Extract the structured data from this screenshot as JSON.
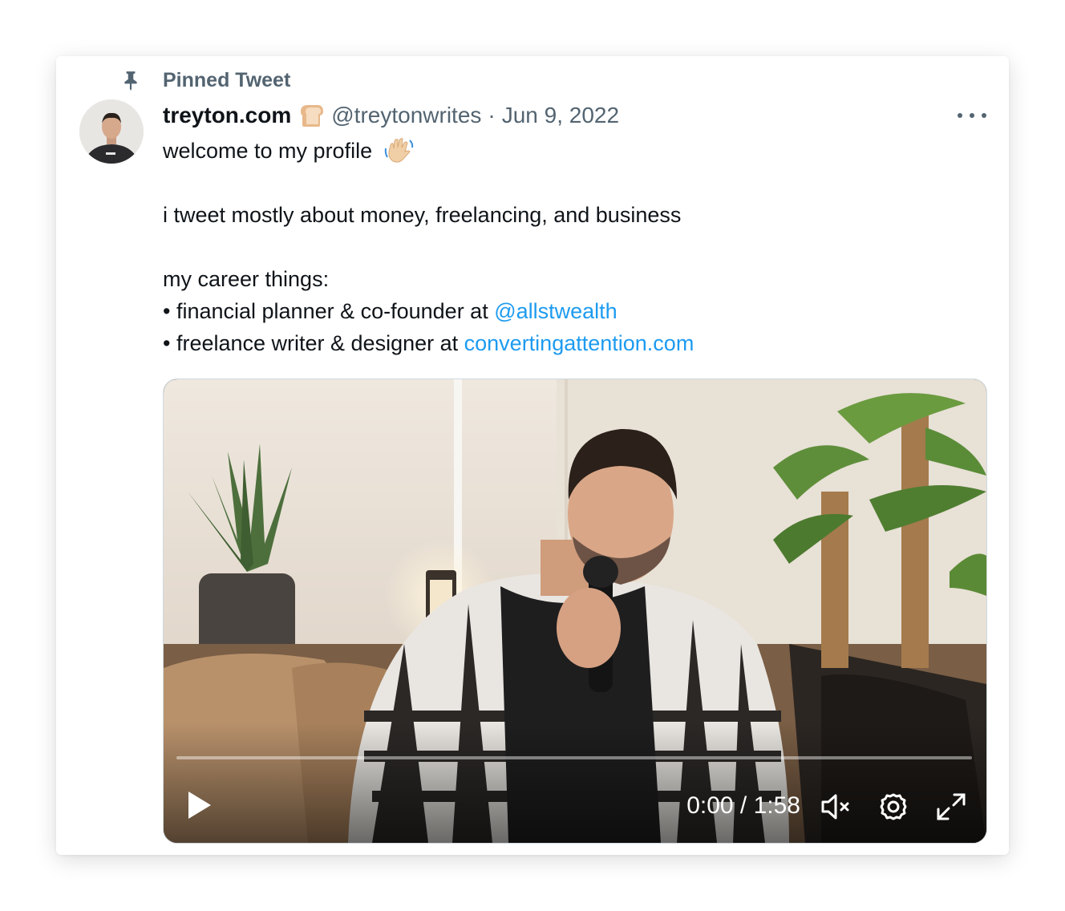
{
  "pinned": {
    "label": "Pinned Tweet"
  },
  "author": {
    "name": "treyton.com",
    "badge_icon": "bread-emoji-icon",
    "handle": "@treytonwrites",
    "separator": "·",
    "date": "Jun 9, 2022"
  },
  "menu": {
    "icon": "more-options-icon"
  },
  "tweet": {
    "line1": "welcome to my profile",
    "line1_emoji": "waving-hand-emoji-icon",
    "line2": "i tweet mostly about money, freelancing, and business",
    "line3": "my career things:",
    "line4_prefix": "• financial planner & co-founder at ",
    "line4_link": "@allstwealth",
    "line5_prefix": "• freelance writer & designer at ",
    "line5_link": "convertingattention.com"
  },
  "video": {
    "current_time": "0:00",
    "duration": "1:58",
    "time_display": "0:00 / 1:58",
    "progress_fraction": 0,
    "muted": true
  },
  "colors": {
    "link": "#1d9bf0",
    "secondary_text": "#536471",
    "primary_text": "#0f1419"
  }
}
